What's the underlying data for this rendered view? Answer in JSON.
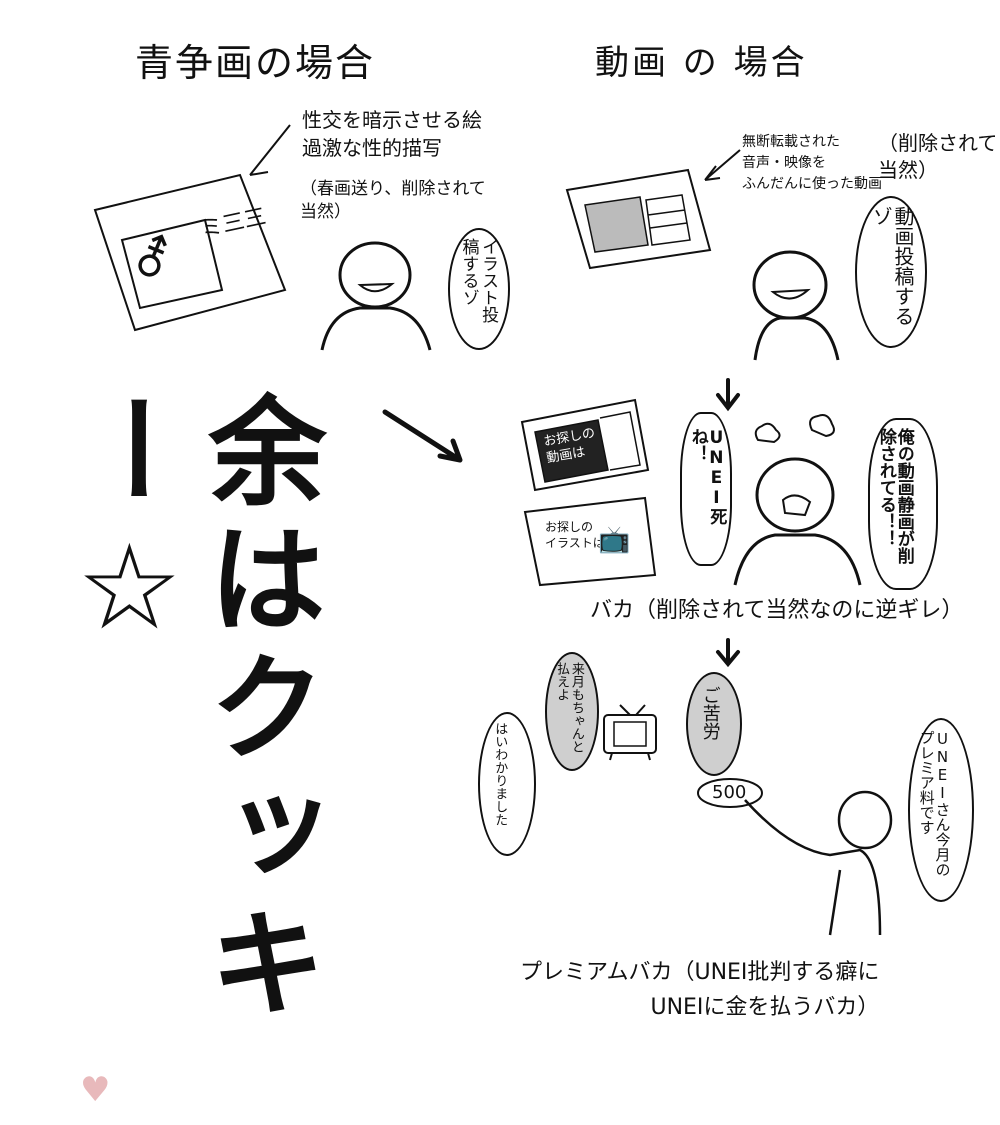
{
  "left": {
    "heading": "青争画の場合",
    "note": "性交を暗示させる絵\n過激な性的描写",
    "note2": "（春画送り、削除されて\n当然）",
    "speech": "イラスト投稿するゾ",
    "panel_text": "ミ三三"
  },
  "right": {
    "heading": "動画 の 場合",
    "note": "無断転載された\n音声・映像を\nふんだんに使った動画",
    "note2": "（削除されて\n当然）",
    "speech": "動画投稿するゾ",
    "screen1": "お探しの\n動画は",
    "screen2": "お探しの\nイラストは",
    "shout1": "UNEI死ね！",
    "shout2": "俺の動画静画が削除されてる！！",
    "caption1": "バカ（削除されて当然なのに逆ギレ）",
    "bubble_a": "来月もちゃんと払えよ",
    "bubble_b": "ご苦労",
    "bubble_c": "はいわかりました",
    "bubble_d": "UNEIさん今月のプレミア料です",
    "coin": "500",
    "caption2": "プレミアムバカ（UNEI批判する癖に\nUNEIに金を払うバカ）"
  },
  "big_text": "余はクッキー☆",
  "colors": {
    "ink": "#111111",
    "tone": "#cfcfcf",
    "heart": "#e8b9bb"
  },
  "icons": [
    "arrow-icon",
    "star-icon",
    "heart-icon",
    "tv-icon",
    "venus-mars-icon"
  ]
}
